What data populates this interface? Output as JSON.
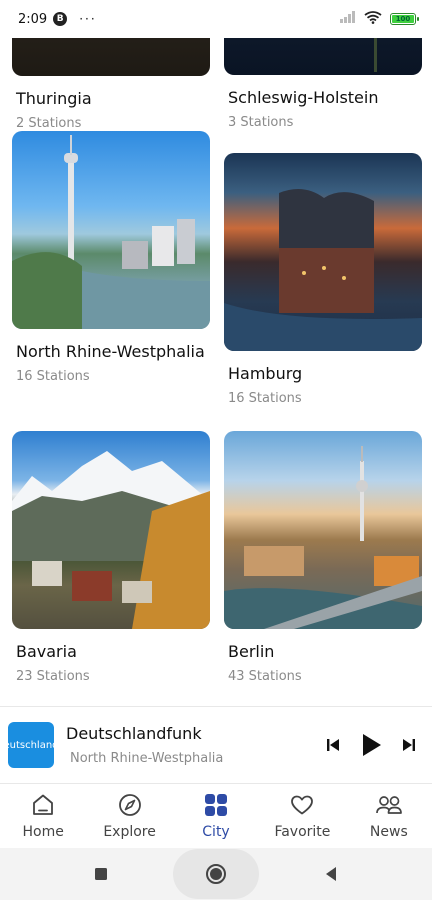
{
  "status_bar": {
    "time": "2:09",
    "badge": "B",
    "dots": "···",
    "battery": "100"
  },
  "cards": [
    {
      "name": "Thuringia",
      "count": "2 Stations"
    },
    {
      "name": "Schleswig-Holstein",
      "count": "3 Stations"
    },
    {
      "name": "North Rhine-Westphalia",
      "count": "16 Stations"
    },
    {
      "name": "Hamburg",
      "count": "16 Stations"
    },
    {
      "name": "Bavaria",
      "count": "23 Stations"
    },
    {
      "name": "Berlin",
      "count": "43 Stations"
    }
  ],
  "player": {
    "logo_text": "eutschland",
    "title": "Deutschlandfunk",
    "subtitle": "North Rhine-Westphalia"
  },
  "nav": {
    "items": [
      {
        "label": "Home",
        "icon": "home-icon"
      },
      {
        "label": "Explore",
        "icon": "compass-icon"
      },
      {
        "label": "City",
        "icon": "grid-icon"
      },
      {
        "label": "Favorite",
        "icon": "heart-icon"
      },
      {
        "label": "News",
        "icon": "people-icon"
      }
    ],
    "active_color": "#2e4ba6"
  },
  "colors": {
    "accent": "#2e4ba6",
    "player_logo": "#1a8ee0"
  }
}
